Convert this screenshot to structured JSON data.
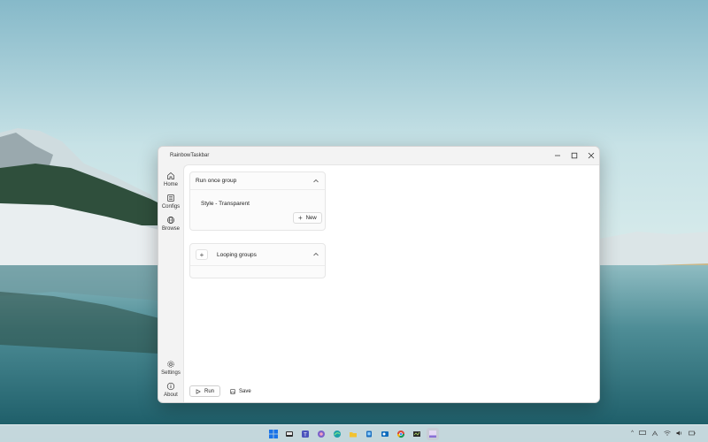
{
  "window": {
    "title": "RainbowTaskbar"
  },
  "sidebar": {
    "items": [
      {
        "label": "Home",
        "icon": "home-icon"
      },
      {
        "label": "Configs",
        "icon": "list-icon"
      },
      {
        "label": "Browse",
        "icon": "globe-icon"
      },
      {
        "label": "Settings",
        "icon": "gear-icon"
      },
      {
        "label": "About",
        "icon": "info-icon"
      }
    ]
  },
  "main": {
    "run_once_group": {
      "title": "Run once group",
      "items": [
        "Style - Transparent"
      ],
      "new_label": "New"
    },
    "looping_groups": {
      "title": "Looping groups"
    }
  },
  "footer": {
    "run_label": "Run",
    "save_label": "Save"
  },
  "taskbar": {
    "icons": [
      "start-icon",
      "search-icon",
      "task-view-icon",
      "teams-icon",
      "edge-icon",
      "file-explorer-icon",
      "store-icon",
      "outlook-icon",
      "chrome-icon",
      "app-icon",
      "rainbowtaskbar-icon"
    ],
    "colors": {
      "start": "#1a73e8",
      "edge": "#1da1a8",
      "explorer": "#f2c230",
      "chrome": "#db4437"
    }
  }
}
